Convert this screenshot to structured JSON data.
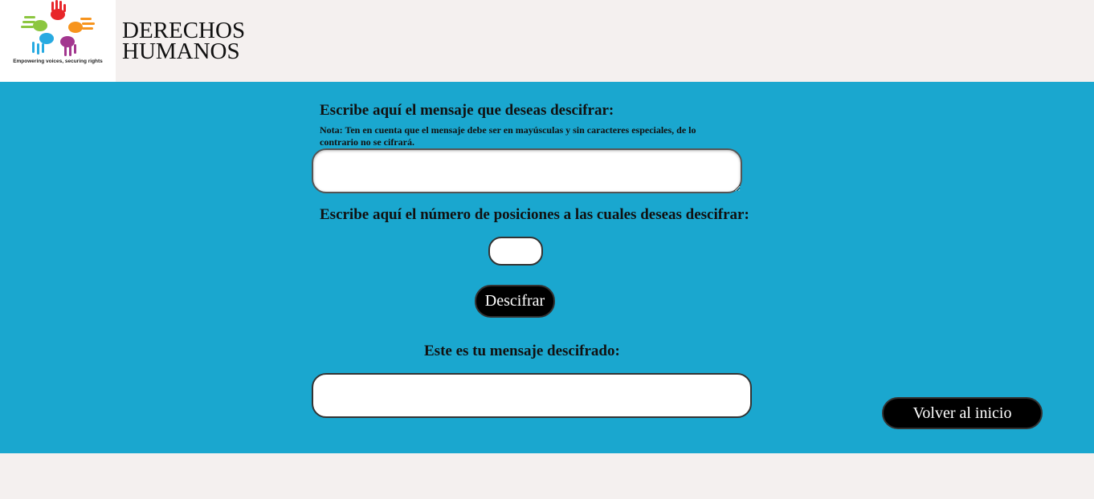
{
  "header": {
    "logo_tagline": "Empowering voices, securing rights",
    "title_line1": "DERECHOS",
    "title_line2": "HUMANOS"
  },
  "form": {
    "message_label": "Escribe aquí el mensaje que deseas descifrar:",
    "note": "Nota: Ten en cuenta que el mensaje debe ser en mayúsculas y sin caracteres especiales, de lo contrario no se cifrará.",
    "message_value": "",
    "positions_label": "Escribe aquí el número de posiciones a las cuales deseas descifrar:",
    "positions_value": "",
    "decrypt_button": "Descifrar",
    "result_label": "Este es tu mensaje descifrado:",
    "result_value": ""
  },
  "nav": {
    "home_button": "Volver al inicio"
  },
  "colors": {
    "main_background": "#1aa7cf",
    "page_background": "#f4f0ef",
    "button_background": "#000000"
  }
}
